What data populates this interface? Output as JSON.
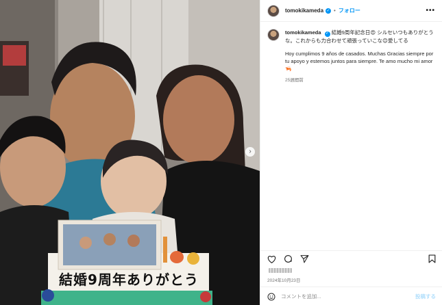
{
  "post": {
    "username": "tomokikameda",
    "follow_label": "フォロー",
    "more_label": "•••",
    "caption_jp": "結婚9周年記念日😍 シルセいつもありがとうな。これからも力合わせて頑張っていこな😊愛してる",
    "caption_es": "Hoy cumplimos 9 años de casados. Muchas Gracias siempre por tu apoyo y estemos juntos para siempre. Te amo mucho mi amor 🦐",
    "time_ago": "25週間前",
    "likes_suffix": "",
    "date": "2024年10月23日",
    "comment_placeholder": "コメントを追加...",
    "post_label": "投稿する",
    "cake_text": "結婚9周年ありがとう"
  },
  "icons": {
    "verified": "verified-badge-icon",
    "heart": "heart-icon",
    "comment": "comment-icon",
    "share": "share-icon",
    "save": "bookmark-icon",
    "emoji": "emoji-icon",
    "next": "chevron-right-icon"
  },
  "colors": {
    "link_blue": "#0095f6",
    "post_disabled": "#b2dffc",
    "muted_text": "#737373",
    "divider": "#efefef"
  }
}
